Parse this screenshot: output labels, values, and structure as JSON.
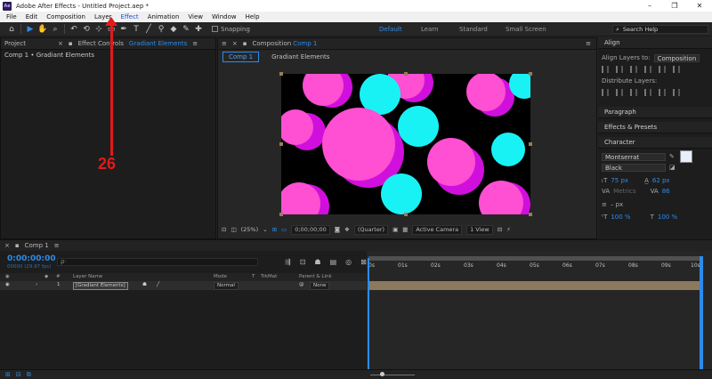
{
  "window": {
    "app_icon": "Ae",
    "title": "Adobe After Effects - Untitled Project.aep *",
    "controls": [
      "–",
      "❐",
      "✕"
    ]
  },
  "menu": [
    "File",
    "Edit",
    "Composition",
    "Layer",
    "Effect",
    "Animation",
    "View",
    "Window",
    "Help"
  ],
  "toolbar": {
    "tools": [
      "home-icon",
      "selection-tool-icon",
      "hand-tool-icon",
      "zoom-tool-icon",
      "orbit-tool-icon",
      "pan-tool-icon",
      "dolly-tool-icon",
      "rotate-tool-icon",
      "pan-behind-tool-icon",
      "rectangle-tool-icon",
      "pen-tool-icon",
      "type-tool-icon",
      "brush-tool-icon",
      "clone-stamp-tool-icon",
      "eraser-tool-icon",
      "roto-brush-tool-icon",
      "puppet-tool-icon"
    ],
    "snapping_label": "Snapping",
    "workspaces": [
      "Default",
      "Learn",
      "Standard",
      "Small Screen"
    ],
    "active_workspace": "Default",
    "search_placeholder": "Search Help"
  },
  "project_panel": {
    "tab_project": "Project",
    "tab_effect_controls": "Effect Controls",
    "tab_effect_target": "Gradiant Elements",
    "breadcrumb": "Comp 1 • Gradiant Elements"
  },
  "composition_panel": {
    "tab_label": "Composition",
    "tab_target": "Comp 1",
    "sub_tabs": [
      "Comp 1",
      "Gradiant Elements"
    ],
    "viewer_bar": {
      "zoom": "(25%)",
      "timecode": "0;00;00;00",
      "resolution": "(Quarter)",
      "camera": "Active Camera",
      "views": "1 View"
    }
  },
  "right_panels": {
    "align": {
      "title": "Align",
      "align_layers_to_label": "Align Layers to:",
      "align_layers_to_value": "Composition",
      "distribute_label": "Distribute Layers:"
    },
    "paragraph_title": "Paragraph",
    "effects_presets_title": "Effects & Presets",
    "character": {
      "title": "Character",
      "font": "Montserrat",
      "style": "Black",
      "font_size": "75 px",
      "leading": "62 px",
      "kerning": "Metrics",
      "tracking": "86",
      "stroke_unit": "– px",
      "vert_scale": "100 %",
      "horiz_scale": "100 %"
    }
  },
  "timeline": {
    "tab_label": "Comp 1",
    "timecode": "0:00:00:00",
    "fps": "00000 (29.97 fps)",
    "search_placeholder": "ρ·",
    "columns": {
      "num": "#",
      "layer_name": "Layer Name",
      "mode": "Mode",
      "t": "T",
      "trkmat": "TrkMat",
      "parent": "Parent & Link"
    },
    "layers": [
      {
        "index": "1",
        "name": "[Gradiant Elements]",
        "mode": "Normal",
        "parent": "None"
      }
    ],
    "ruler_labels": [
      "0s",
      "01s",
      "02s",
      "03s",
      "04s",
      "05s",
      "06s",
      "07s",
      "08s",
      "09s",
      "10s"
    ]
  },
  "annotation": {
    "number": "26",
    "color": "#e11a1a"
  },
  "colors": {
    "accent": "#2d8ceb",
    "magenta": "#ff4fd2",
    "purple_shadow": "#d10fdc",
    "cyan": "#19f2f5",
    "layer_bar": "#8c7a5e"
  }
}
